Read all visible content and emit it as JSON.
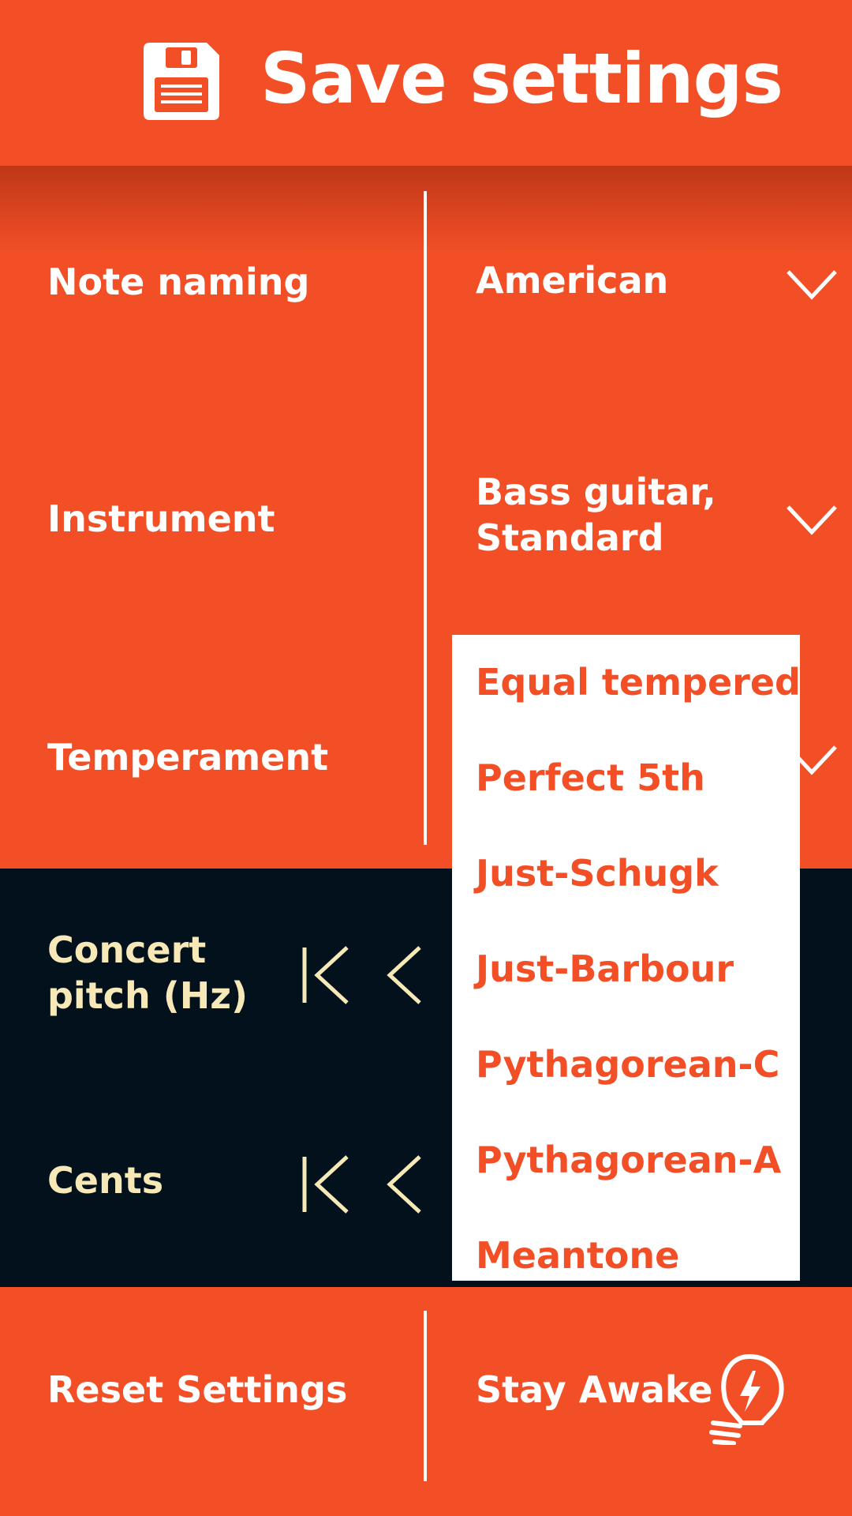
{
  "header": {
    "title": "Save settings",
    "icon": "floppy-disk-icon"
  },
  "settings": {
    "note_naming": {
      "label": "Note naming",
      "value": "American"
    },
    "instrument": {
      "label": "Instrument",
      "value_line1": "Bass guitar,",
      "value_line2": "Standard"
    },
    "temperament": {
      "label": "Temperament"
    }
  },
  "dark_section": {
    "concert_pitch": {
      "label_line1": "Concert",
      "label_line2": "pitch (Hz)"
    },
    "cents": {
      "label": "Cents"
    }
  },
  "dropdown": {
    "options": [
      "Equal tempered",
      "Perfect 5th",
      "Just-Schugk",
      "Just-Barbour",
      "Pythagorean-C",
      "Pythagorean-A",
      "Meantone"
    ]
  },
  "bottom": {
    "reset_label": "Reset Settings",
    "stay_awake_label": "Stay Awake",
    "stay_awake_icon": "lightbulb-bolt-icon"
  },
  "colors": {
    "accent": "#f24f27",
    "dark_bg": "#02111b",
    "cream_text": "#f7e8b8",
    "white": "#ffffff"
  }
}
